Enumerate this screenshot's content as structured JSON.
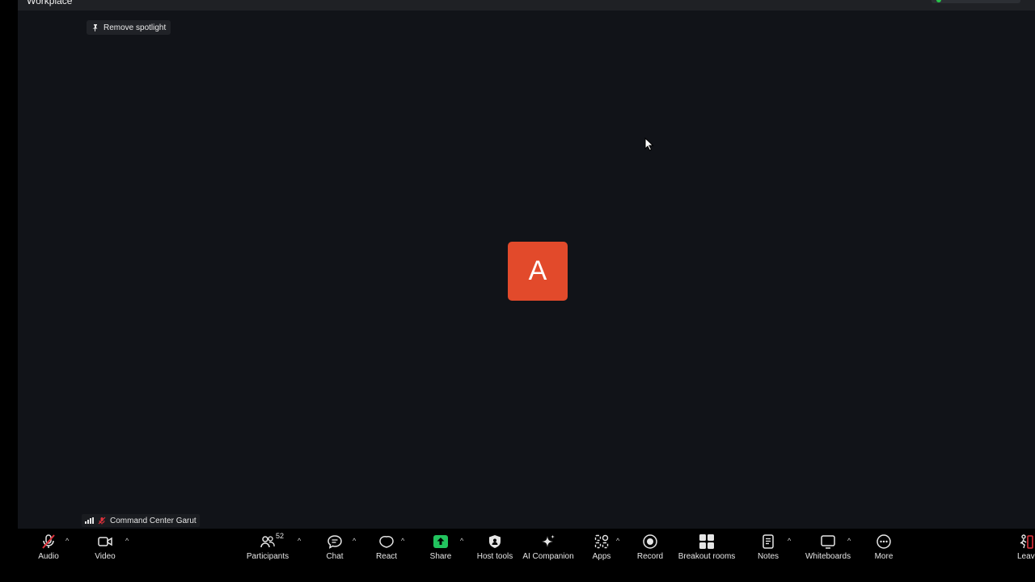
{
  "window": {
    "title": "Workplace"
  },
  "stage": {
    "spotlight_label": "Remove spotlight",
    "avatar_letter": "A",
    "avatar_color": "#e24a2b",
    "participant_name": "Command Center Garut"
  },
  "toolbar": {
    "audio": "Audio",
    "video": "Video",
    "participants": "Participants",
    "participants_count": "52",
    "chat": "Chat",
    "react": "React",
    "share": "Share",
    "host_tools": "Host tools",
    "ai_companion": "AI Companion",
    "apps": "Apps",
    "record": "Record",
    "breakout_rooms": "Breakout rooms",
    "notes": "Notes",
    "whiteboards": "Whiteboards",
    "more": "More",
    "leave": "Leave",
    "caret": "^"
  },
  "colors": {
    "share_green": "#22c35e",
    "muted_red": "#e0323c",
    "leave_red": "#e0323c"
  }
}
